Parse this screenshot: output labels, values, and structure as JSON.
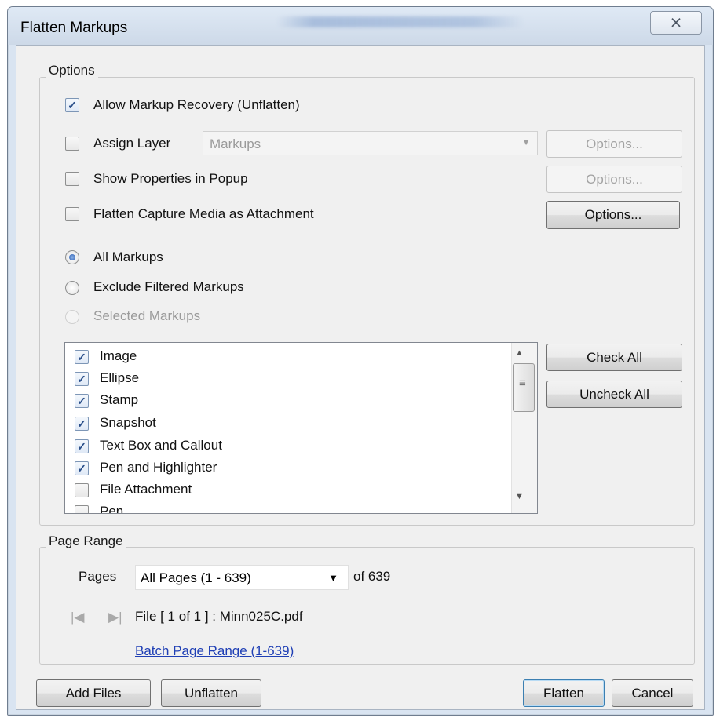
{
  "window": {
    "title": "Flatten Markups",
    "close_glyph": "⨯"
  },
  "options": {
    "group_title": "Options",
    "allow_recovery_label": "Allow Markup Recovery (Unflatten)",
    "allow_recovery_checked": true,
    "assign_layer_label": "Assign Layer",
    "assign_layer_checked": false,
    "layer_value": "Markups",
    "assign_layer_options_label": "Options...",
    "show_properties_label": "Show Properties in Popup",
    "show_properties_checked": false,
    "show_properties_options_label": "Options...",
    "flatten_capture_label": "Flatten Capture Media as Attachment",
    "flatten_capture_checked": false,
    "flatten_capture_options_label": "Options..."
  },
  "scope": {
    "all_markups_label": "All Markups",
    "exclude_filtered_label": "Exclude Filtered Markups",
    "selected_markups_label": "Selected Markups",
    "selected": "All Markups"
  },
  "markup_types": [
    {
      "label": "Image",
      "checked": true
    },
    {
      "label": "Ellipse",
      "checked": true
    },
    {
      "label": "Stamp",
      "checked": true
    },
    {
      "label": "Snapshot",
      "checked": true
    },
    {
      "label": "Text Box and Callout",
      "checked": true
    },
    {
      "label": "Pen and Highlighter",
      "checked": true
    },
    {
      "label": "File Attachment",
      "checked": false
    },
    {
      "label": "Pen",
      "checked": false
    }
  ],
  "list_buttons": {
    "check_all_label": "Check All",
    "uncheck_all_label": "Uncheck All"
  },
  "page_range": {
    "group_title": "Page Range",
    "pages_label": "Pages",
    "pages_value": "All Pages (1 - 639)",
    "of_total": "of 639",
    "file_info": "File [ 1 of 1 ] :  Minn025C.pdf",
    "batch_link": "Batch Page Range (1-639)"
  },
  "footer": {
    "add_files_label": "Add Files",
    "unflatten_label": "Unflatten",
    "flatten_label": "Flatten",
    "cancel_label": "Cancel"
  },
  "colors": {
    "link": "#1f3fb5",
    "check_mark": "#2a4f8a",
    "title_bar": "#d9e4f1"
  }
}
